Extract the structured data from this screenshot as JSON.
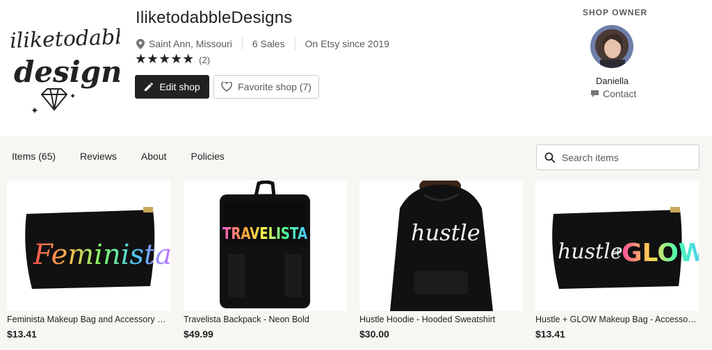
{
  "shop": {
    "logo_text_line1": "iliketodabble",
    "logo_text_line2": "designs",
    "name": "IliketodabbleDesigns",
    "location": "Saint Ann, Missouri",
    "sales": "6 Sales",
    "since": "On Etsy since 2019",
    "stars": "★★★★★",
    "rating_count": "(2)",
    "edit_label": "Edit shop",
    "favorite_label": "Favorite shop (7)"
  },
  "owner": {
    "heading": "SHOP OWNER",
    "name": "Daniella",
    "contact_label": "Contact"
  },
  "nav": {
    "tabs": [
      "Items (65)",
      "Reviews",
      "About",
      "Policies"
    ]
  },
  "search": {
    "placeholder": "Search items"
  },
  "listings": [
    {
      "title": "Feminista Makeup Bag and Accessory Pouch",
      "price": "$13.41",
      "art_text": "Feminista"
    },
    {
      "title": "Travelista Backpack - Neon Bold",
      "price": "$49.99",
      "art_text": "TRAVELISTA"
    },
    {
      "title": "Hustle Hoodie - Hooded Sweatshirt",
      "price": "$30.00",
      "art_text": "hustle"
    },
    {
      "title": "Hustle + GLOW Makeup Bag - Accessory Pouch",
      "price": "$13.41",
      "art_text_a": "hustle",
      "art_text_b": "+",
      "art_text_c": "GLOW"
    }
  ],
  "colors": {
    "button_dark": "#222222",
    "band_bg": "#f7f6f3",
    "muted_text": "#595959"
  },
  "icons": [
    "location-pin-icon",
    "pencil-icon",
    "heart-icon",
    "message-icon",
    "search-icon",
    "diamond-icon"
  ]
}
